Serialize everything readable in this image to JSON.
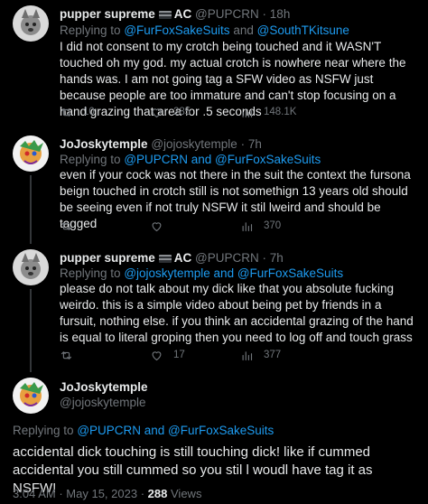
{
  "tweets": [
    {
      "name": "pupper supreme",
      "badge": "AC",
      "handle": "@PUPCRN",
      "time": "18h",
      "reply_prefix": "Replying to",
      "reply_users": "@FurFoxSakeSuits",
      "reply_and": "and",
      "reply_more": "@SouthTKitsune",
      "text": "I did not consent to my crotch being touched and it WASN'T touched oh my god. my actual crotch is nowhere near where the hands was. I am not going tag a SFW video as NSFW just because people are too immature and can't stop focusing on a hand grazing that area for .5 seconds",
      "retweets": "10",
      "likes": "285",
      "views": "148.1K"
    },
    {
      "name": "JoJoskytemple",
      "handle": "@jojoskytemple",
      "time": "7h",
      "reply_prefix": "Replying to",
      "reply_users": "@PUPCRN and @FurFoxSakeSuits",
      "text": "even if your cock was not there in the suit the context the fursona beign touched in crotch still is not somethign 13 years old should be seeing even if not truly NSFW it stil lweird and should be tagged",
      "views": "370"
    },
    {
      "name": "pupper supreme",
      "badge": "AC",
      "handle": "@PUPCRN",
      "time": "7h",
      "reply_prefix": "Replying to",
      "reply_users": "@jojoskytemple and @FurFoxSakeSuits",
      "text": "please do not talk about my dick like that you absolute fucking weirdo. this is a simple video about being pet by friends in a fursuit, nothing else. if you think an accidental grazing of the hand is equal to literal groping then you need to log off and touch grass",
      "likes": "17",
      "views": "377"
    }
  ],
  "main_tweet": {
    "name": "JoJoskytemple",
    "handle": "@jojoskytemple",
    "reply_prefix": "Replying to",
    "reply_users": "@PUPCRN and @FurFoxSakeSuits",
    "text": "accidental  dick touching is  still  touching dick! like  if cummed accidental you still cummed so you stil l woudl have  tag it  as NSFW!",
    "time": "3:04 AM",
    "date": "May 15, 2023",
    "views": "288",
    "views_label": "Views"
  }
}
